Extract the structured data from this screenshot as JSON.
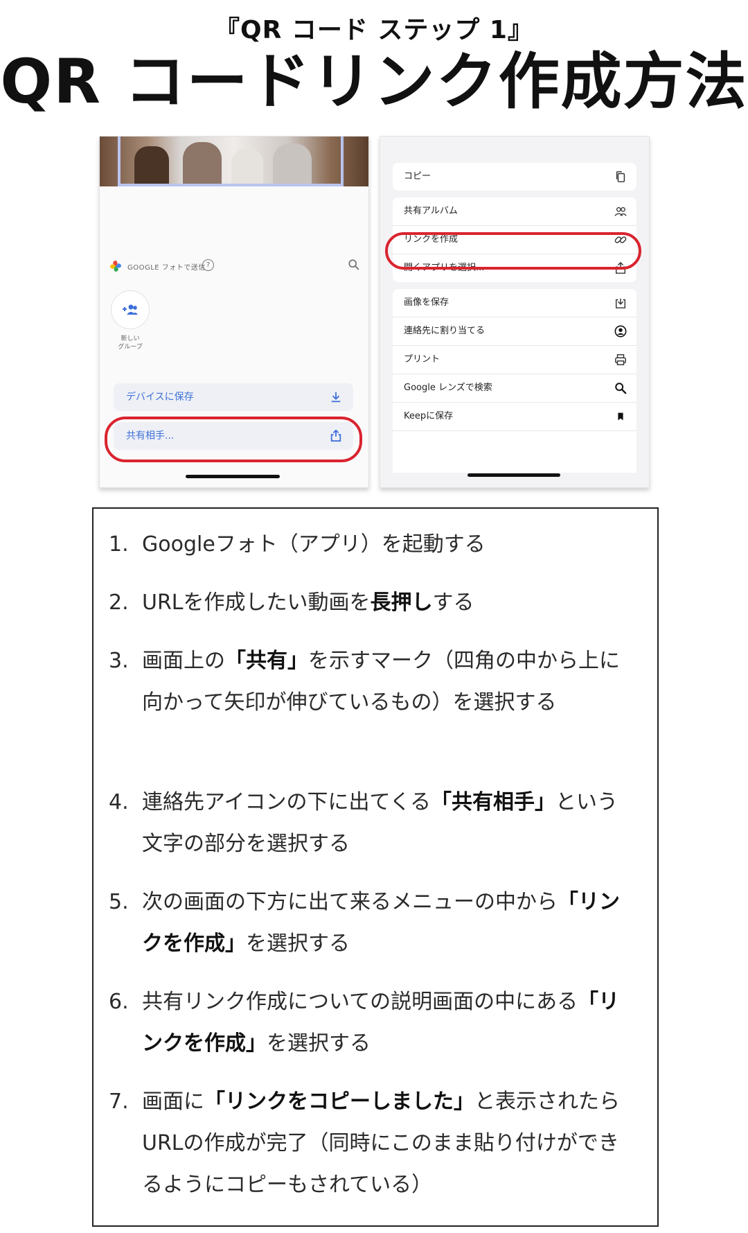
{
  "header": {
    "subtitle": "『QR コード ステップ 1』",
    "title": "QR コードリンク作成方法"
  },
  "left_screen": {
    "google_photos_label": "GOOGLE フォトで送信",
    "help_glyph": "?",
    "new_group_label_line1": "新しい",
    "new_group_label_line2": "グループ",
    "save_to_device": "デバイスに保存",
    "share_with": "共有相手..."
  },
  "right_screen": {
    "menu_items": [
      {
        "label": "コピー",
        "icon": "copy-icon"
      },
      {
        "label": "共有アルバム",
        "icon": "people-icon"
      },
      {
        "label": "リンクを作成",
        "icon": "link-icon"
      },
      {
        "label": "開くアプリを選択...",
        "icon": "share-icon"
      },
      {
        "label": "画像を保存",
        "icon": "download-icon"
      },
      {
        "label": "連絡先に割り当てる",
        "icon": "contact-icon"
      },
      {
        "label": "プリント",
        "icon": "print-icon"
      },
      {
        "label": "Google レンズで検索",
        "icon": "search-icon"
      },
      {
        "label": "Keepに保存",
        "icon": "bookmark-icon"
      }
    ]
  },
  "steps": [
    {
      "num": "1.",
      "parts": [
        "Googleフォト（アプリ）を起動する"
      ]
    },
    {
      "num": "2.",
      "parts": [
        "URLを作成したい動画を",
        "長押し",
        "する"
      ]
    },
    {
      "num": "3.",
      "parts": [
        "画面上の",
        "「共有」",
        "を示すマーク（四角の中から上に向かって矢印が伸びているもの）を選択する"
      ]
    },
    {
      "num": "4.",
      "parts": [
        "連絡先アイコンの下に出てくる",
        "「共有相手」",
        "という文字の部分を選択する"
      ]
    },
    {
      "num": "5.",
      "parts": [
        "次の画面の下方に出て来るメニューの中から",
        "「リンクを作成」",
        "を選択する"
      ]
    },
    {
      "num": "6.",
      "parts": [
        "共有リンク作成についての説明画面の中にある",
        "「リンクを作成」",
        "を選択する"
      ]
    },
    {
      "num": "7.",
      "parts": [
        "画面に",
        "「リンクをコピーしました」",
        "と表示されたらURLの作成が完了（同時にこのまま貼り付けができるようにコピーもされている）"
      ]
    }
  ],
  "colors": {
    "highlight_red": "#d9242f",
    "accent_blue": "#3d6fd9"
  }
}
